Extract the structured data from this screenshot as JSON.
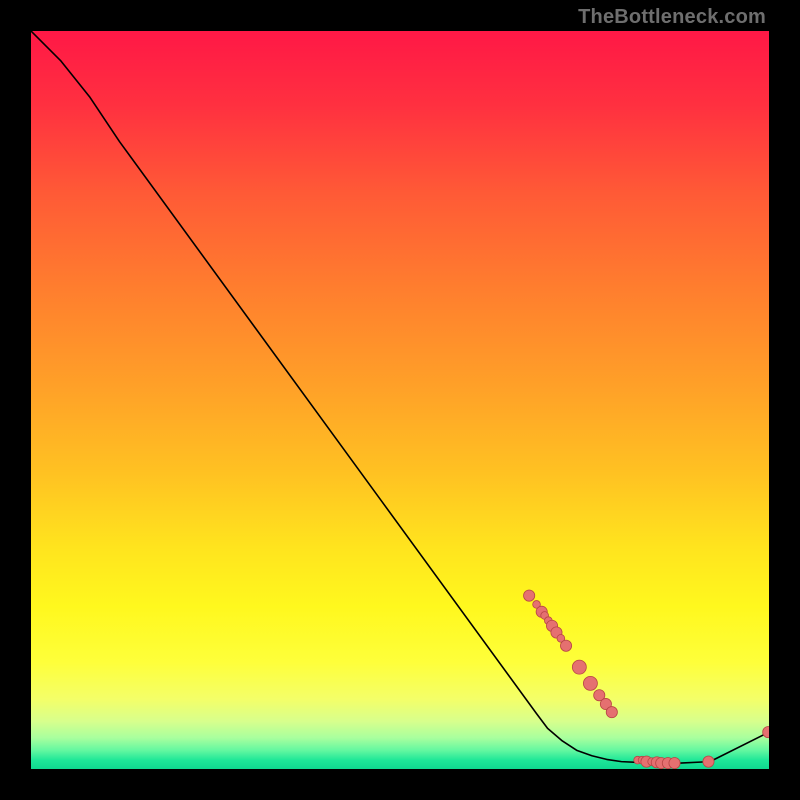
{
  "attribution": "TheBottleneck.com",
  "colors": {
    "point_fill": "#e57070",
    "point_stroke": "#b84545",
    "curve": "#000000"
  },
  "gradient_stops": [
    {
      "pos": 0.0,
      "color": "#ff1846"
    },
    {
      "pos": 0.1,
      "color": "#ff3040"
    },
    {
      "pos": 0.22,
      "color": "#ff5a36"
    },
    {
      "pos": 0.35,
      "color": "#ff7e2e"
    },
    {
      "pos": 0.48,
      "color": "#ffa028"
    },
    {
      "pos": 0.6,
      "color": "#ffc222"
    },
    {
      "pos": 0.7,
      "color": "#ffe41e"
    },
    {
      "pos": 0.78,
      "color": "#fff81e"
    },
    {
      "pos": 0.855,
      "color": "#feff3a"
    },
    {
      "pos": 0.905,
      "color": "#f4ff68"
    },
    {
      "pos": 0.935,
      "color": "#d8ff8c"
    },
    {
      "pos": 0.958,
      "color": "#a8ff9e"
    },
    {
      "pos": 0.975,
      "color": "#62f7a0"
    },
    {
      "pos": 0.988,
      "color": "#1ee798"
    },
    {
      "pos": 1.0,
      "color": "#0fd890"
    }
  ],
  "chart_data": {
    "type": "line",
    "title": "",
    "xlabel": "",
    "ylabel": "",
    "xlim": [
      0,
      100
    ],
    "ylim": [
      0,
      100
    ],
    "curve": [
      {
        "x": 0,
        "y": 100
      },
      {
        "x": 4,
        "y": 96
      },
      {
        "x": 8,
        "y": 91
      },
      {
        "x": 12,
        "y": 85
      },
      {
        "x": 68.5,
        "y": 7.5
      },
      {
        "x": 70,
        "y": 5.5
      },
      {
        "x": 72,
        "y": 3.8
      },
      {
        "x": 74,
        "y": 2.5
      },
      {
        "x": 76,
        "y": 1.8
      },
      {
        "x": 78,
        "y": 1.3
      },
      {
        "x": 80,
        "y": 1.0
      },
      {
        "x": 84,
        "y": 0.8
      },
      {
        "x": 88,
        "y": 0.8
      },
      {
        "x": 92,
        "y": 1.0
      },
      {
        "x": 100,
        "y": 5.0
      }
    ],
    "points": [
      {
        "x": 67.5,
        "y": 23.5,
        "r": 0.8
      },
      {
        "x": 68.5,
        "y": 22.3,
        "r": 0.55
      },
      {
        "x": 69.2,
        "y": 21.3,
        "r": 0.8
      },
      {
        "x": 69.6,
        "y": 20.8,
        "r": 0.55
      },
      {
        "x": 70.1,
        "y": 20.1,
        "r": 0.55
      },
      {
        "x": 70.6,
        "y": 19.4,
        "r": 0.8
      },
      {
        "x": 71.2,
        "y": 18.5,
        "r": 0.8
      },
      {
        "x": 71.8,
        "y": 17.7,
        "r": 0.55
      },
      {
        "x": 72.5,
        "y": 16.7,
        "r": 0.8
      },
      {
        "x": 74.3,
        "y": 13.8,
        "r": 1.0
      },
      {
        "x": 75.8,
        "y": 11.6,
        "r": 1.0
      },
      {
        "x": 77.0,
        "y": 10.0,
        "r": 0.8
      },
      {
        "x": 77.9,
        "y": 8.8,
        "r": 0.8
      },
      {
        "x": 78.7,
        "y": 7.7,
        "r": 0.8
      },
      {
        "x": 82.2,
        "y": 1.2,
        "r": 0.55
      },
      {
        "x": 82.8,
        "y": 1.2,
        "r": 0.55
      },
      {
        "x": 83.4,
        "y": 1.0,
        "r": 0.8
      },
      {
        "x": 84.1,
        "y": 1.0,
        "r": 0.55
      },
      {
        "x": 84.8,
        "y": 0.9,
        "r": 0.8
      },
      {
        "x": 85.4,
        "y": 0.8,
        "r": 0.8
      },
      {
        "x": 86.3,
        "y": 0.8,
        "r": 0.8
      },
      {
        "x": 87.2,
        "y": 0.8,
        "r": 0.8
      },
      {
        "x": 91.8,
        "y": 1.0,
        "r": 0.8
      },
      {
        "x": 99.9,
        "y": 5.0,
        "r": 0.8
      }
    ]
  }
}
